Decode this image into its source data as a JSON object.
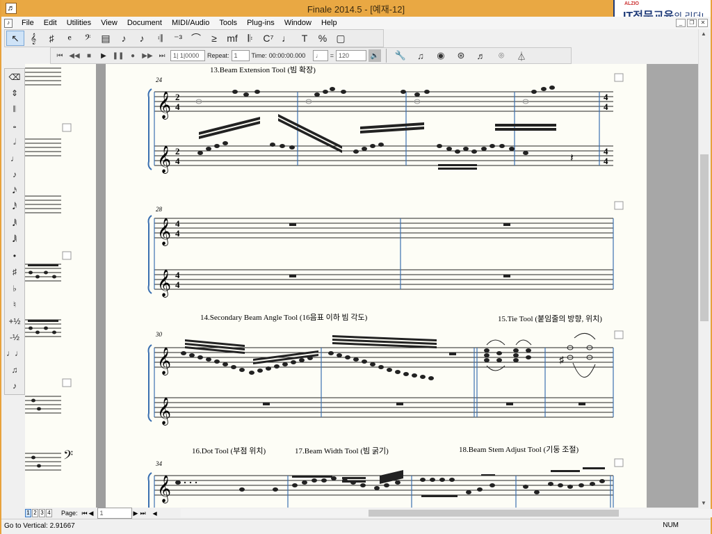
{
  "window": {
    "title": "Finale 2014.5 - [예재-12]",
    "logo_brand": "ALZIO",
    "logo_text": "IT전문교육",
    "logo_suffix": "의 리더!"
  },
  "menu": [
    "File",
    "Edit",
    "Utilities",
    "View",
    "Document",
    "MIDI/Audio",
    "Tools",
    "Plug-ins",
    "Window",
    "Help"
  ],
  "tools_main": [
    {
      "name": "selection-tool",
      "glyph": "↖",
      "selected": true
    },
    {
      "name": "staff-tool",
      "glyph": "𝄞"
    },
    {
      "name": "key-signature-tool",
      "glyph": "♯"
    },
    {
      "name": "time-signature-tool",
      "glyph": "𝄴"
    },
    {
      "name": "clef-tool",
      "glyph": "𝄢"
    },
    {
      "name": "measure-tool",
      "glyph": "▤"
    },
    {
      "name": "simple-entry-tool",
      "glyph": "♪"
    },
    {
      "name": "speedy-entry-tool",
      "glyph": "♪"
    },
    {
      "name": "hyperscribe-tool",
      "glyph": "𝄇"
    },
    {
      "name": "tuplet-tool",
      "glyph": "⁻³"
    },
    {
      "name": "smart-shape-tool",
      "glyph": "⌒"
    },
    {
      "name": "articulation-tool",
      "glyph": "≥"
    },
    {
      "name": "expression-tool",
      "glyph": "mf"
    },
    {
      "name": "repeat-tool",
      "glyph": "𝄆"
    },
    {
      "name": "chord-tool",
      "glyph": "C⁷"
    },
    {
      "name": "lyrics-tool",
      "glyph": "♩"
    },
    {
      "name": "text-tool",
      "glyph": "T"
    },
    {
      "name": "resize-tool",
      "glyph": "%"
    },
    {
      "name": "page-layout-tool",
      "glyph": "▢"
    }
  ],
  "playback": {
    "measure_field": "1| 1|0000",
    "repeat_label": "Repeat:",
    "repeat_value": "1",
    "time_label": "Time:",
    "time_value": "00:00:00.000",
    "tempo_eq": "=",
    "tempo_value": "120"
  },
  "tools_secondary": [
    "wrench-icon",
    "notes-icon",
    "mixer-icon",
    "studio-icon",
    "beam-icon",
    "special-icon",
    "metronome-icon"
  ],
  "palette": [
    {
      "name": "eraser",
      "glyph": "⌫"
    },
    {
      "name": "up-down",
      "glyph": "⇕"
    },
    {
      "name": "tablet",
      "glyph": "𝄃"
    },
    {
      "name": "whole-note",
      "glyph": "𝅝"
    },
    {
      "name": "half-note",
      "glyph": "𝅗𝅥"
    },
    {
      "name": "quarter-note",
      "glyph": "♩"
    },
    {
      "name": "eighth-note",
      "glyph": "♪"
    },
    {
      "name": "sixteenth-note",
      "glyph": "𝅘𝅥𝅯"
    },
    {
      "name": "32nd-note",
      "glyph": "𝅘𝅥𝅰"
    },
    {
      "name": "64th-note",
      "glyph": "𝅘𝅥𝅱"
    },
    {
      "name": "128th-note",
      "glyph": "𝅘𝅥𝅲"
    },
    {
      "name": "dot",
      "glyph": "•"
    },
    {
      "name": "sharp",
      "glyph": "♯"
    },
    {
      "name": "flat",
      "glyph": "♭"
    },
    {
      "name": "natural",
      "glyph": "♮"
    },
    {
      "name": "half-step-up",
      "glyph": "+½"
    },
    {
      "name": "half-step-down",
      "glyph": "-½"
    },
    {
      "name": "tie",
      "glyph": "♩♩"
    },
    {
      "name": "beam",
      "glyph": "♫"
    },
    {
      "name": "grace-note",
      "glyph": "♪"
    }
  ],
  "score": {
    "headings": [
      {
        "text": "13.Beam Extension Tool (빔 확장)"
      },
      {
        "text": "14.Secondary Beam Angle Tool (16음표 이하 빔 각도)"
      },
      {
        "text": "15.Tie Tool (붙임줄의 방향, 위치)"
      },
      {
        "text": "16.Dot Tool (부점 위치)"
      },
      {
        "text": "17.Beam Width Tool (빔 굵기)"
      },
      {
        "text": "18.Beam Stem Adjust Tool (기둥 조절)"
      }
    ],
    "measure_numbers": [
      "24",
      "28",
      "30",
      "34"
    ],
    "time_sig_top": "2",
    "time_sig_bottom": "4",
    "time_sig2_top": "4",
    "time_sig2_bottom": "4"
  },
  "bottom": {
    "page_tabs": [
      "1",
      "2",
      "3",
      "4"
    ],
    "page_label": "Page:",
    "page_value": "1"
  },
  "status": {
    "text": "Go to Vertical: 2.91667",
    "num": "NUM"
  },
  "colors": {
    "titlebar": "#e9a843",
    "barline": "#3a6fb0"
  }
}
